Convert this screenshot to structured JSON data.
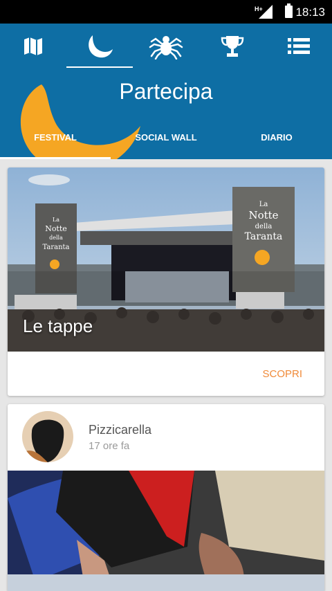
{
  "status_bar": {
    "network": "H+",
    "time": "18:13"
  },
  "header": {
    "title": "Partecipa",
    "nav": [
      {
        "icon": "map-icon"
      },
      {
        "icon": "moon-icon",
        "active": true
      },
      {
        "icon": "spider-icon"
      },
      {
        "icon": "trophy-icon"
      },
      {
        "icon": "list-menu-icon"
      }
    ],
    "tabs": [
      {
        "label": "FESTIVAL",
        "active": true
      },
      {
        "label": "SOCIAL WALL"
      },
      {
        "label": "DIARIO"
      }
    ]
  },
  "feed": {
    "stage_card": {
      "title": "Le tappe",
      "action": "SCOPRI",
      "banner_left": "La Notte della Taranta",
      "banner_right": "La Notte della Taranta"
    },
    "post": {
      "author": "Pizzicarella",
      "time": "17 ore fa"
    }
  },
  "colors": {
    "header": "#0e6ea4",
    "accent": "#f5a623",
    "action": "#f08a38"
  }
}
